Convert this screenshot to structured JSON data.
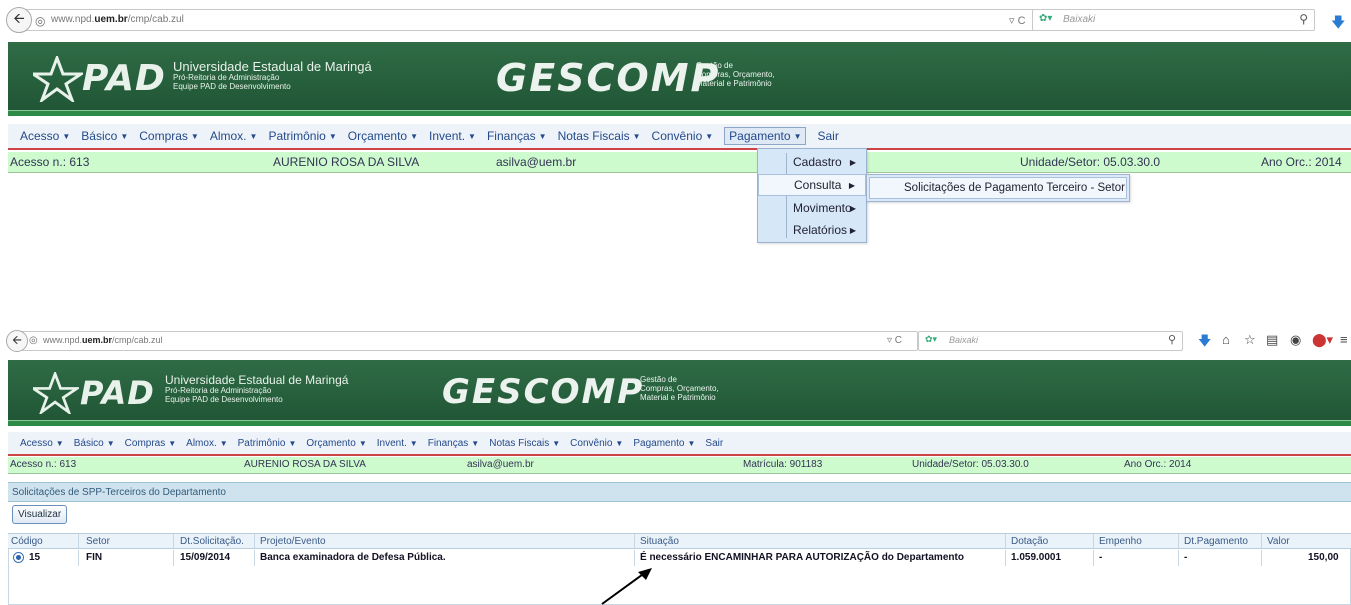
{
  "browser": {
    "url_prefix": "www.npd.",
    "url_domain": "uem.br",
    "url_path": "/cmp/cab.zul",
    "search_placeholder": "Baixaki"
  },
  "header": {
    "pad_logo": "PAD",
    "university": "Universidade Estadual de Maringá",
    "dept_line1": "Pró-Reitoria de Administração",
    "dept_line2": "Equipe PAD de Desenvolvimento",
    "system_name": "GESCOMP",
    "system_sub1": "Gestão de",
    "system_sub2": "Compras, Orçamento,",
    "system_sub3": "Material e Patrimônio"
  },
  "menu": {
    "items": [
      "Acesso",
      "Básico",
      "Compras",
      "Almox.",
      "Patrimônio",
      "Orçamento",
      "Invent.",
      "Finanças",
      "Notas Fiscais",
      "Convênio",
      "Pagamento"
    ],
    "sair": "Sair"
  },
  "info": {
    "acesso": "Acesso n.: 613",
    "user": "AURENIO ROSA DA SILVA",
    "email": "asilva@uem.br",
    "matricula": "Matrícula: 901183",
    "unidade": "Unidade/Setor: 05.03.30.0",
    "ano": "Ano Orc.: 2014"
  },
  "dropdown": {
    "items": [
      "Cadastro",
      "Consulta",
      "Movimento",
      "Relatórios"
    ],
    "submenu_item": "Solicitações de Pagamento Terceiro - Setor"
  },
  "panel": {
    "title": "Solicitações de SPP-Terceiros do Departamento",
    "visualizar": "Visualizar",
    "columns": [
      "Código",
      "Setor",
      "Dt.Solicitação.",
      "Projeto/Evento",
      "Situação",
      "Dotação",
      "Empenho",
      "Dt.Pagamento",
      "Valor"
    ],
    "row": {
      "codigo": "15",
      "setor": "FIN",
      "data": "15/09/2014",
      "projeto": "Banca examinadora de Defesa Pública.",
      "situacao": "É necessário ENCAMINHAR PARA AUTORIZAÇÃO do Departamento",
      "dotacao": "1.059.0001",
      "empenho": "-",
      "dt_pagamento": "-",
      "valor": "150,00"
    }
  }
}
